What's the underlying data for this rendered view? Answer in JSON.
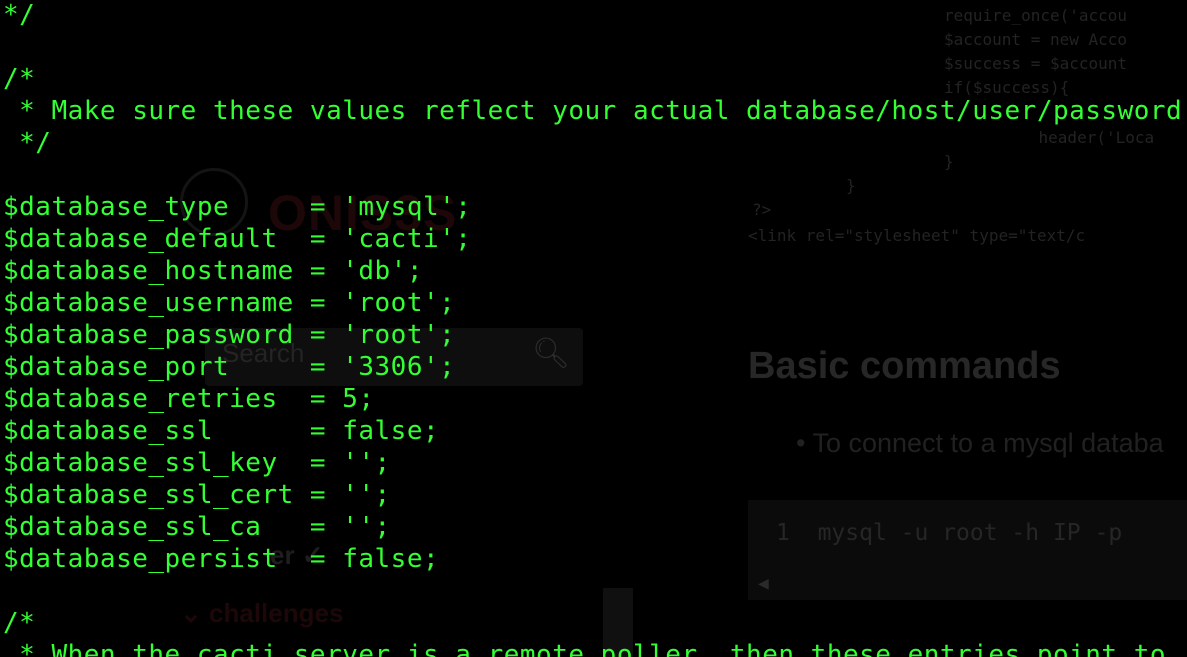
{
  "background_page": {
    "code_snippet": [
      "require_once('accou",
      "$account = new Acco",
      "$success = $account",
      "if($success){",
      "    header('Loca",
      "}",
      "}",
      "?>",
      "<link rel=\"stylesheet\" type=\"text/c"
    ],
    "logo_text": "ONIS3S",
    "search_placeholder": "Search",
    "search_icon": "search-icon",
    "heading": "Basic commands",
    "bullet_text": "To connect to a mysql databa",
    "code_line_number": "1",
    "code_line": "mysql -u root -h IP -p",
    "nav_items": [
      "er",
      "challenges"
    ]
  },
  "terminal": {
    "text_color": "#33ff33",
    "background_color": "#000000",
    "lines": [
      "*/",
      "",
      "/*",
      " * Make sure these values reflect your actual database/host/user/password",
      " */",
      "",
      "$database_type     = 'mysql';",
      "$database_default  = 'cacti';",
      "$database_hostname = 'db';",
      "$database_username = 'root';",
      "$database_password = 'root';",
      "$database_port     = '3306';",
      "$database_retries  = 5;",
      "$database_ssl      = false;",
      "$database_ssl_key  = '';",
      "$database_ssl_cert = '';",
      "$database_ssl_ca   = '';",
      "$database_persist  = false;",
      "",
      "/*",
      " * When the cacti server is a remote poller, then these entries point to"
    ]
  }
}
